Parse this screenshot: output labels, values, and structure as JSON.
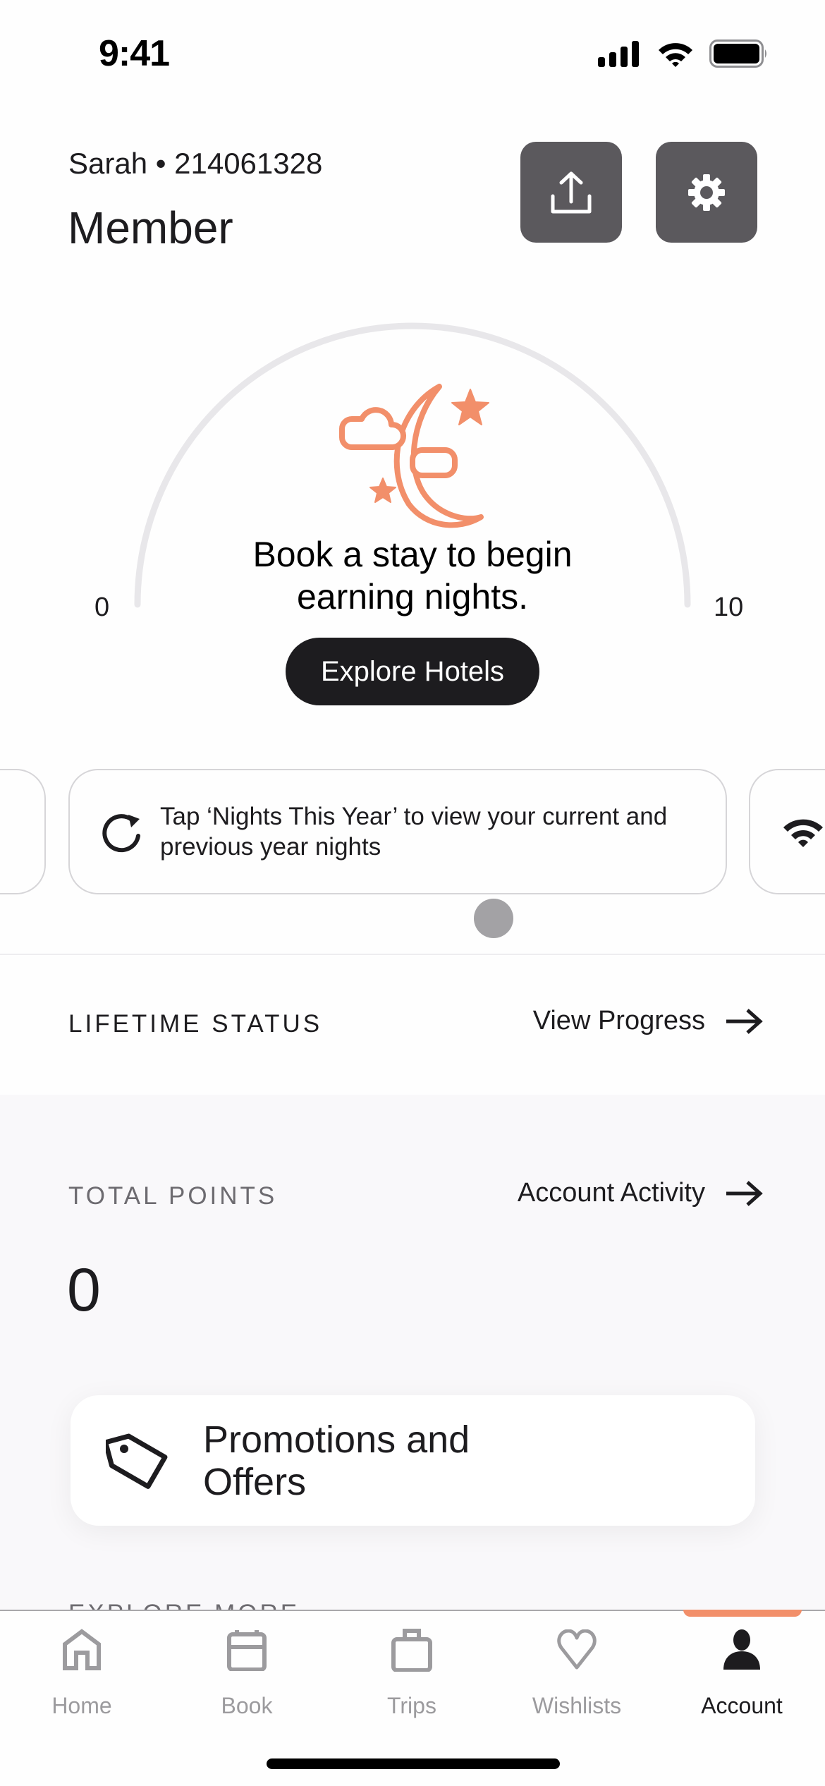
{
  "status_bar": {
    "time": "9:41"
  },
  "header": {
    "member_line": "Sarah • 214061328",
    "tier": "Member",
    "share_button": "share-icon",
    "settings_button": "gear-icon"
  },
  "nights_gauge": {
    "min_label": "0",
    "max_label": "10",
    "current_nights": 0,
    "min": 0,
    "max": 10,
    "message": "Book a stay to begin earning nights.",
    "cta_label": "Explore Hotels",
    "accent_color": "#f28f6a",
    "track_color": "#e8e7ea"
  },
  "carousel": {
    "cards": [
      {
        "icon": "refresh-icon",
        "text": "Tap ‘Nights This Year’ to view your current and previous year nights"
      },
      {
        "icon": "wifi-icon",
        "text": ""
      }
    ],
    "active_index": 1
  },
  "lifetime": {
    "label": "LIFETIME STATUS",
    "link_label": "View Progress"
  },
  "points": {
    "label": "TOTAL POINTS",
    "link_label": "Account Activity",
    "value": "0"
  },
  "promo": {
    "icon": "tag-icon",
    "label": "Promotions and Offers"
  },
  "explore_more": {
    "label": "EXPLORE MORE"
  },
  "tabbar": {
    "active": "Account",
    "active_color": "#f28f6a",
    "items": [
      {
        "label": "Home",
        "icon": "home-icon"
      },
      {
        "label": "Book",
        "icon": "calendar-icon"
      },
      {
        "label": "Trips",
        "icon": "suitcase-icon"
      },
      {
        "label": "Wishlists",
        "icon": "heart-icon"
      },
      {
        "label": "Account",
        "icon": "person-icon"
      }
    ]
  }
}
